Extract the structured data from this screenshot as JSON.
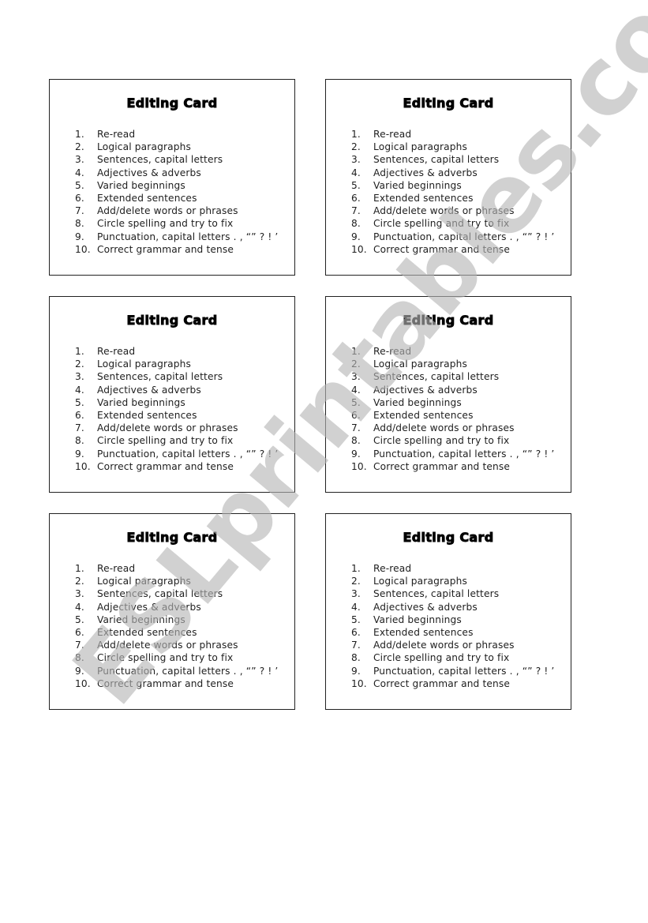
{
  "document": {
    "card_title": "Editing Card",
    "items": [
      {
        "num": "1.",
        "text": "Re-read"
      },
      {
        "num": "2.",
        "text": "Logical paragraphs"
      },
      {
        "num": "3.",
        "text": "Sentences, capital letters"
      },
      {
        "num": "4.",
        "text": "Adjectives & adverbs"
      },
      {
        "num": "5.",
        "text": "Varied beginnings"
      },
      {
        "num": "6.",
        "text": "Extended sentences"
      },
      {
        "num": "7.",
        "text": "Add/delete words or phrases"
      },
      {
        "num": "8.",
        "text": "Circle spelling and try to fix"
      },
      {
        "num": "9.",
        "text": "Punctuation, capital letters . , “” ? ! ’"
      },
      {
        "num": "10.",
        "text": "Correct grammar and tense"
      }
    ],
    "card_count": 6
  },
  "watermark": {
    "text": "ESLprintables.com",
    "color": "#b4b4b4"
  }
}
